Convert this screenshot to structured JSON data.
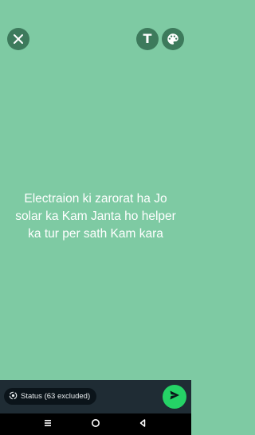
{
  "colors": {
    "background": "#7ecaa3",
    "button_bg": "#3d7a5c",
    "bottom_bar": "#1f2c34",
    "chip_bg": "#0b141a",
    "send": "#25d366"
  },
  "toolbar": {
    "close_icon": "close-icon",
    "text_icon": "text-format-icon",
    "text_label": "T",
    "palette_icon": "palette-icon"
  },
  "status": {
    "lines": [
      "Electraion ki zarorat ha Jo",
      "solar ka Kam Janta ho helper",
      "ka tur per sath Kam kara"
    ]
  },
  "bottom": {
    "privacy_chip_label": "Status (63 excluded)",
    "privacy_icon": "status-privacy-icon",
    "send_icon": "send-icon"
  },
  "navigation": {
    "recents_icon": "recents-icon",
    "home_icon": "home-icon",
    "back_icon": "back-icon"
  }
}
